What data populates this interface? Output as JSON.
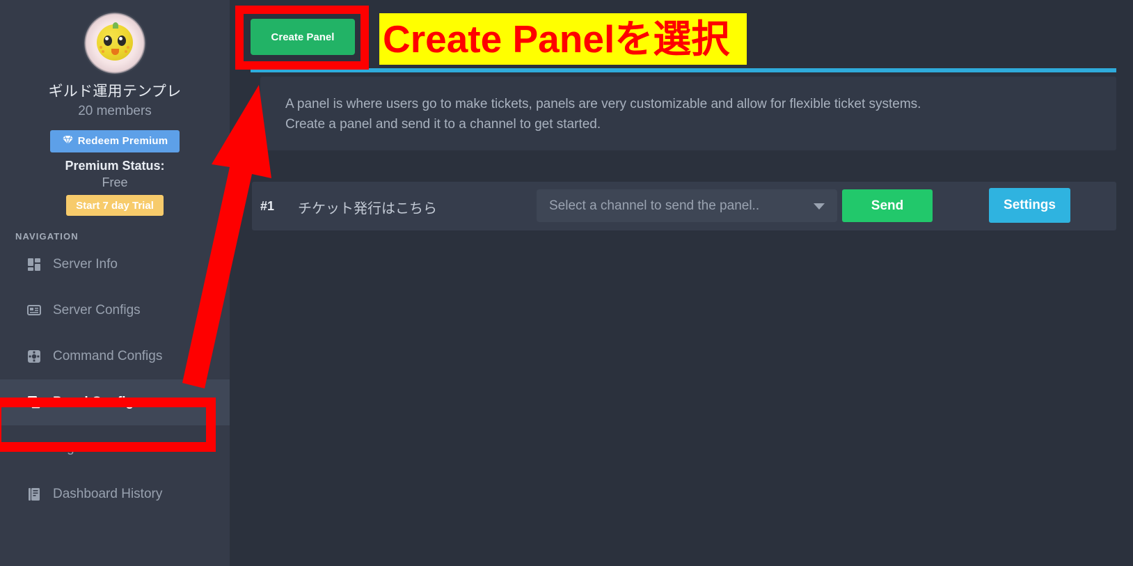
{
  "sidebar": {
    "avatar_alt": "guild-avatar",
    "guild_name": "ギルド運用テンプレ",
    "member_count": "20 members",
    "redeem_premium_label": "Redeem Premium",
    "premium_status_label": "Premium Status:",
    "premium_status_value": "Free",
    "start_trial_label": "Start 7 day Trial",
    "nav_heading": "NAVIGATION",
    "items": [
      {
        "label": "Server Info",
        "icon": "dashboard-grid-icon",
        "active": false
      },
      {
        "label": "Server Configs",
        "icon": "server-card-icon",
        "active": false
      },
      {
        "label": "Command Configs",
        "icon": "gear-square-icon",
        "active": false
      },
      {
        "label": "Panel Configs",
        "icon": "copy-layers-icon",
        "active": true
      },
      {
        "label": "Tags",
        "icon": "tag-icon",
        "active": false
      },
      {
        "label": "Dashboard History",
        "icon": "book-icon",
        "active": false
      }
    ]
  },
  "main": {
    "create_panel_label": "Create Panel",
    "info_line_1": "A panel is where users go to make tickets, panels are very customizable and allow for flexible ticket systems.",
    "info_line_2": "Create a panel and send it to a channel to get started.",
    "panel": {
      "number": "#1",
      "title": "チケット発行はこちら",
      "channel_placeholder": "Select a channel to send the panel..",
      "send_label": "Send",
      "settings_label": "Settings"
    }
  },
  "annotations": {
    "callout_text": "Create Panelを選択",
    "highlight_color": "#ffff00",
    "marker_color": "#fe0000"
  },
  "colors": {
    "sidebar_bg": "#353b49",
    "content_bg": "#2b313d",
    "card_bg": "#323947",
    "row_bg": "#363d4c",
    "accent_blue": "#2fabdb",
    "green": "#22b366",
    "send_green": "#22c86b",
    "settings_blue": "#2fb3e0",
    "premium_blue": "#5da0e8",
    "trial_yellow": "#f7cb6b"
  }
}
